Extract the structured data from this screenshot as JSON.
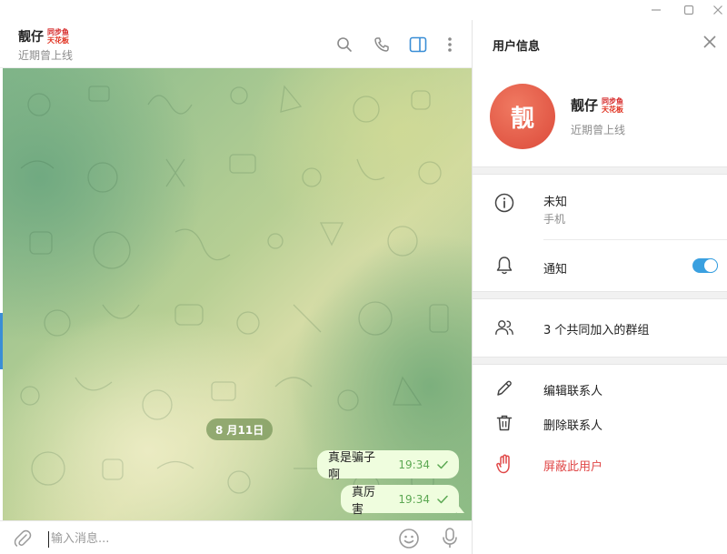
{
  "window": {
    "controls": [
      "minimize-icon",
      "maximize-icon",
      "close-icon"
    ]
  },
  "chat": {
    "peer_name": "靓仔",
    "peer_badge": [
      "同步鱼",
      "天花板"
    ],
    "peer_status": "近期曾上线",
    "header_icons": [
      "search-icon",
      "phone-icon",
      "sidebar-toggle-icon",
      "more-vertical-icon"
    ],
    "date_pill": "8 月11日",
    "messages": [
      {
        "text": "真是骗子啊",
        "time": "19:34",
        "status": "sent-check"
      },
      {
        "text": "真厉害",
        "time": "19:34",
        "status": "sent-check"
      }
    ],
    "composer": {
      "placeholder": "输入消息..."
    }
  },
  "panel": {
    "title": "用户信息",
    "avatar_char": "靓",
    "name": "靓仔",
    "badge": [
      "同步鱼",
      "天花板"
    ],
    "status": "近期曾上线",
    "info_label": "未知",
    "info_sub": "手机",
    "notify_label": "通知",
    "notify_on": true,
    "groups_label": "3 个共同加入的群组",
    "edit_contact": "编辑联系人",
    "delete_contact": "删除联系人",
    "block_user": "屏蔽此用户",
    "colors": {
      "accent": "#3aa0e0",
      "danger": "#e04848",
      "avatar": "#e25a45",
      "bubble": "#effdde",
      "time": "#5ca853"
    }
  }
}
